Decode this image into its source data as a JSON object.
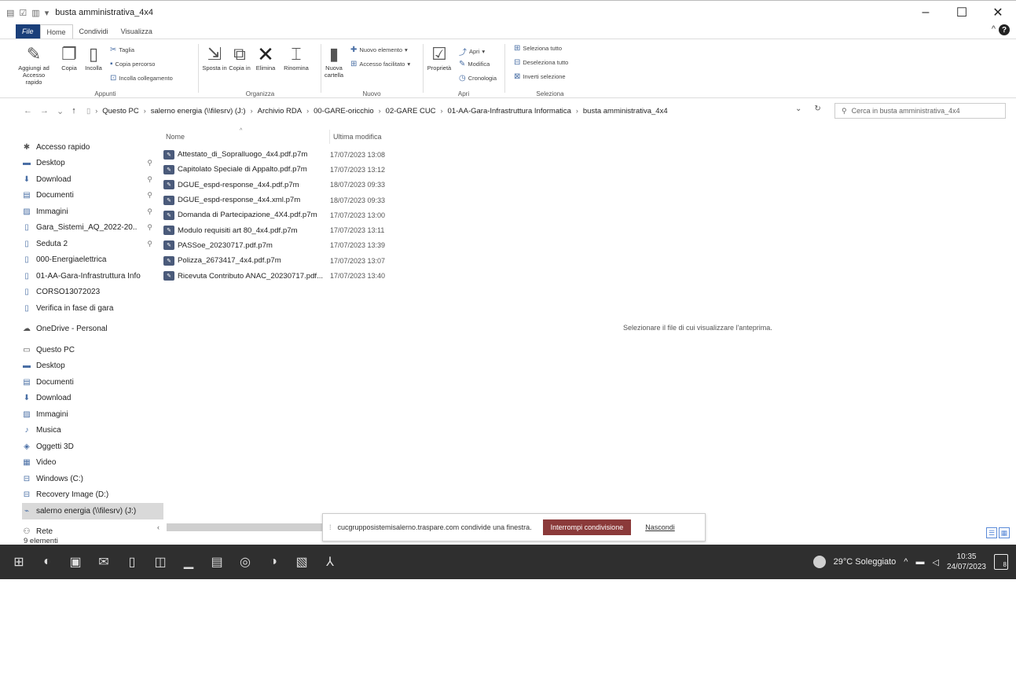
{
  "window": {
    "title": "busta amministrativa_4x4",
    "minimize": "–",
    "maximize": "☐",
    "close": "✕"
  },
  "tabs": [
    "File",
    "Home",
    "Condividi",
    "Visualizza"
  ],
  "ribbon": {
    "appunti": {
      "label": "Appunti",
      "pin": "Aggiungi ad Accesso rapido",
      "copy": "Copia",
      "paste": "Incolla",
      "cut": "Taglia",
      "copy_path": "Copia percorso",
      "paste_link": "Incolla collegamento"
    },
    "organizza": {
      "label": "Organizza",
      "move": "Sposta in",
      "copy_to": "Copia in",
      "delete": "Elimina",
      "rename": "Rinomina"
    },
    "nuovo": {
      "label": "Nuovo",
      "new_folder": "Nuova cartella",
      "new_item": "Nuovo elemento",
      "easy_access": "Accesso facilitato"
    },
    "apri": {
      "label": "Apri",
      "properties": "Proprietà",
      "open": "Apri",
      "edit": "Modifica",
      "history": "Cronologia"
    },
    "seleziona": {
      "label": "Seleziona",
      "select_all": "Seleziona tutto",
      "select_none": "Deseleziona tutto",
      "invert": "Inverti selezione"
    }
  },
  "address": {
    "crumbs": [
      "Questo PC",
      "salerno energia (\\\\filesrv) (J:)",
      "Archivio RDA",
      "00-GARE-oricchio",
      "02-GARE CUC",
      "01-AA-Gara-Infrastruttura Informatica",
      "busta amministrativa_4x4"
    ],
    "search_placeholder": "Cerca in busta amministrativa_4x4"
  },
  "nav": {
    "quick_access": "Accesso rapido",
    "quick_items": [
      {
        "label": "Desktop",
        "icon": "desktop-icon",
        "pinned": true
      },
      {
        "label": "Download",
        "icon": "download-icon",
        "pinned": true
      },
      {
        "label": "Documenti",
        "icon": "documents-icon",
        "pinned": true
      },
      {
        "label": "Immagini",
        "icon": "pictures-icon",
        "pinned": true
      },
      {
        "label": "Gara_Sistemi_AQ_2022-20..",
        "icon": "folder-icon",
        "pinned": true
      },
      {
        "label": "Seduta 2",
        "icon": "folder-icon",
        "pinned": true
      },
      {
        "label": "000-Energiaelettrica",
        "icon": "folder-icon",
        "pinned": false
      },
      {
        "label": "01-AA-Gara-Infrastruttura Info",
        "icon": "folder-icon",
        "pinned": false
      },
      {
        "label": "CORSO13072023",
        "icon": "folder-icon",
        "pinned": false
      },
      {
        "label": "Verifica in fase di gara",
        "icon": "folder-icon",
        "pinned": false
      }
    ],
    "onedrive": "OneDrive - Personal",
    "this_pc": "Questo PC",
    "pc_items": [
      {
        "label": "Desktop",
        "icon": "desktop-icon"
      },
      {
        "label": "Documenti",
        "icon": "documents-icon"
      },
      {
        "label": "Download",
        "icon": "download-icon"
      },
      {
        "label": "Immagini",
        "icon": "pictures-icon"
      },
      {
        "label": "Musica",
        "icon": "music-icon"
      },
      {
        "label": "Oggetti 3D",
        "icon": "3d-objects-icon"
      },
      {
        "label": "Video",
        "icon": "video-icon"
      },
      {
        "label": "Windows (C:)",
        "icon": "drive-icon"
      },
      {
        "label": "Recovery Image (D:)",
        "icon": "drive-icon"
      },
      {
        "label": "salerno energia (\\\\filesrv) (J:)",
        "icon": "network-drive-icon"
      }
    ],
    "network": "Rete"
  },
  "list": {
    "col_name": "Nome",
    "col_modified": "Ultima modifica",
    "files": [
      {
        "name": "Attestato_di_Sopralluogo_4x4.pdf.p7m",
        "modified": "17/07/2023 13:08"
      },
      {
        "name": "Capitolato Speciale di Appalto.pdf.p7m",
        "modified": "17/07/2023 13:12"
      },
      {
        "name": "DGUE_espd-response_4x4.pdf.p7m",
        "modified": "18/07/2023 09:33"
      },
      {
        "name": "DGUE_espd-response_4x4.xml.p7m",
        "modified": "18/07/2023 09:33"
      },
      {
        "name": "Domanda di Partecipazione_4X4.pdf.p7m",
        "modified": "17/07/2023 13:00"
      },
      {
        "name": "Modulo requisiti art 80_4x4.pdf.p7m",
        "modified": "17/07/2023 13:11"
      },
      {
        "name": "PASSoe_20230717.pdf.p7m",
        "modified": "17/07/2023 13:39"
      },
      {
        "name": "Polizza_2673417_4x4.pdf.p7m",
        "modified": "17/07/2023 13:07"
      },
      {
        "name": "Ricevuta Contributo ANAC_20230717.pdf...",
        "modified": "17/07/2023 13:40"
      }
    ],
    "preview_message": "Selezionare il file di cui visualizzare l'anteprima."
  },
  "status": {
    "count": "9 elementi"
  },
  "share": {
    "message": "cucgrupposistemisalerno.traspare.com condivide una finestra.",
    "stop": "Interrompi condivisione",
    "hide": "Nascondi"
  },
  "taskbar": {
    "weather": "29°C Soleggiato",
    "time": "10:35",
    "date": "24/07/2023",
    "notif_count": "8"
  }
}
